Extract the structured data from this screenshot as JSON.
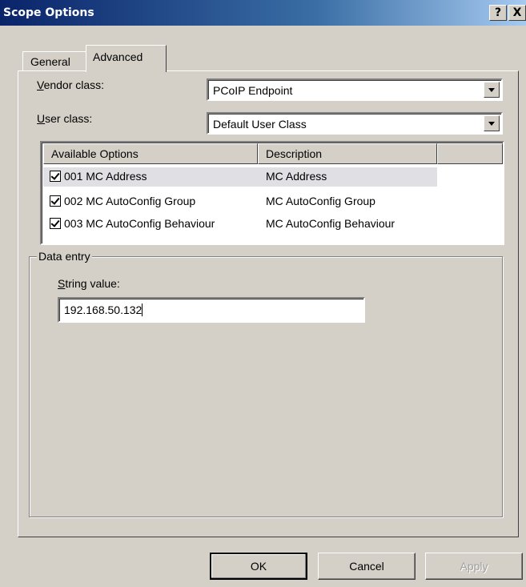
{
  "window": {
    "title": "Scope Options",
    "help_glyph": "?",
    "close_glyph": "X"
  },
  "tabs": [
    {
      "label": "General",
      "active": false
    },
    {
      "label": "Advanced",
      "active": true
    }
  ],
  "vendor_class": {
    "label_accel": "V",
    "label_rest": "endor class:",
    "value": "PCoIP Endpoint"
  },
  "user_class": {
    "label_accel": "U",
    "label_rest": "ser class:",
    "value": "Default User Class"
  },
  "options_list": {
    "columns": [
      "Available Options",
      "Description"
    ],
    "rows": [
      {
        "option": "001 MC Address",
        "description": "MC Address",
        "checked": true,
        "selected": true
      },
      {
        "option": "002 MC AutoConfig Group",
        "description": "MC AutoConfig Group",
        "checked": true,
        "selected": false
      },
      {
        "option": "003 MC AutoConfig Behaviour",
        "description": "MC AutoConfig Behaviour",
        "checked": true,
        "selected": false
      }
    ]
  },
  "data_entry": {
    "group_title": "Data entry",
    "string_label_accel": "S",
    "string_label_rest": "tring value:",
    "string_value": "192.168.50.132"
  },
  "buttons": {
    "ok": "OK",
    "cancel": "Cancel",
    "apply": "Apply"
  }
}
